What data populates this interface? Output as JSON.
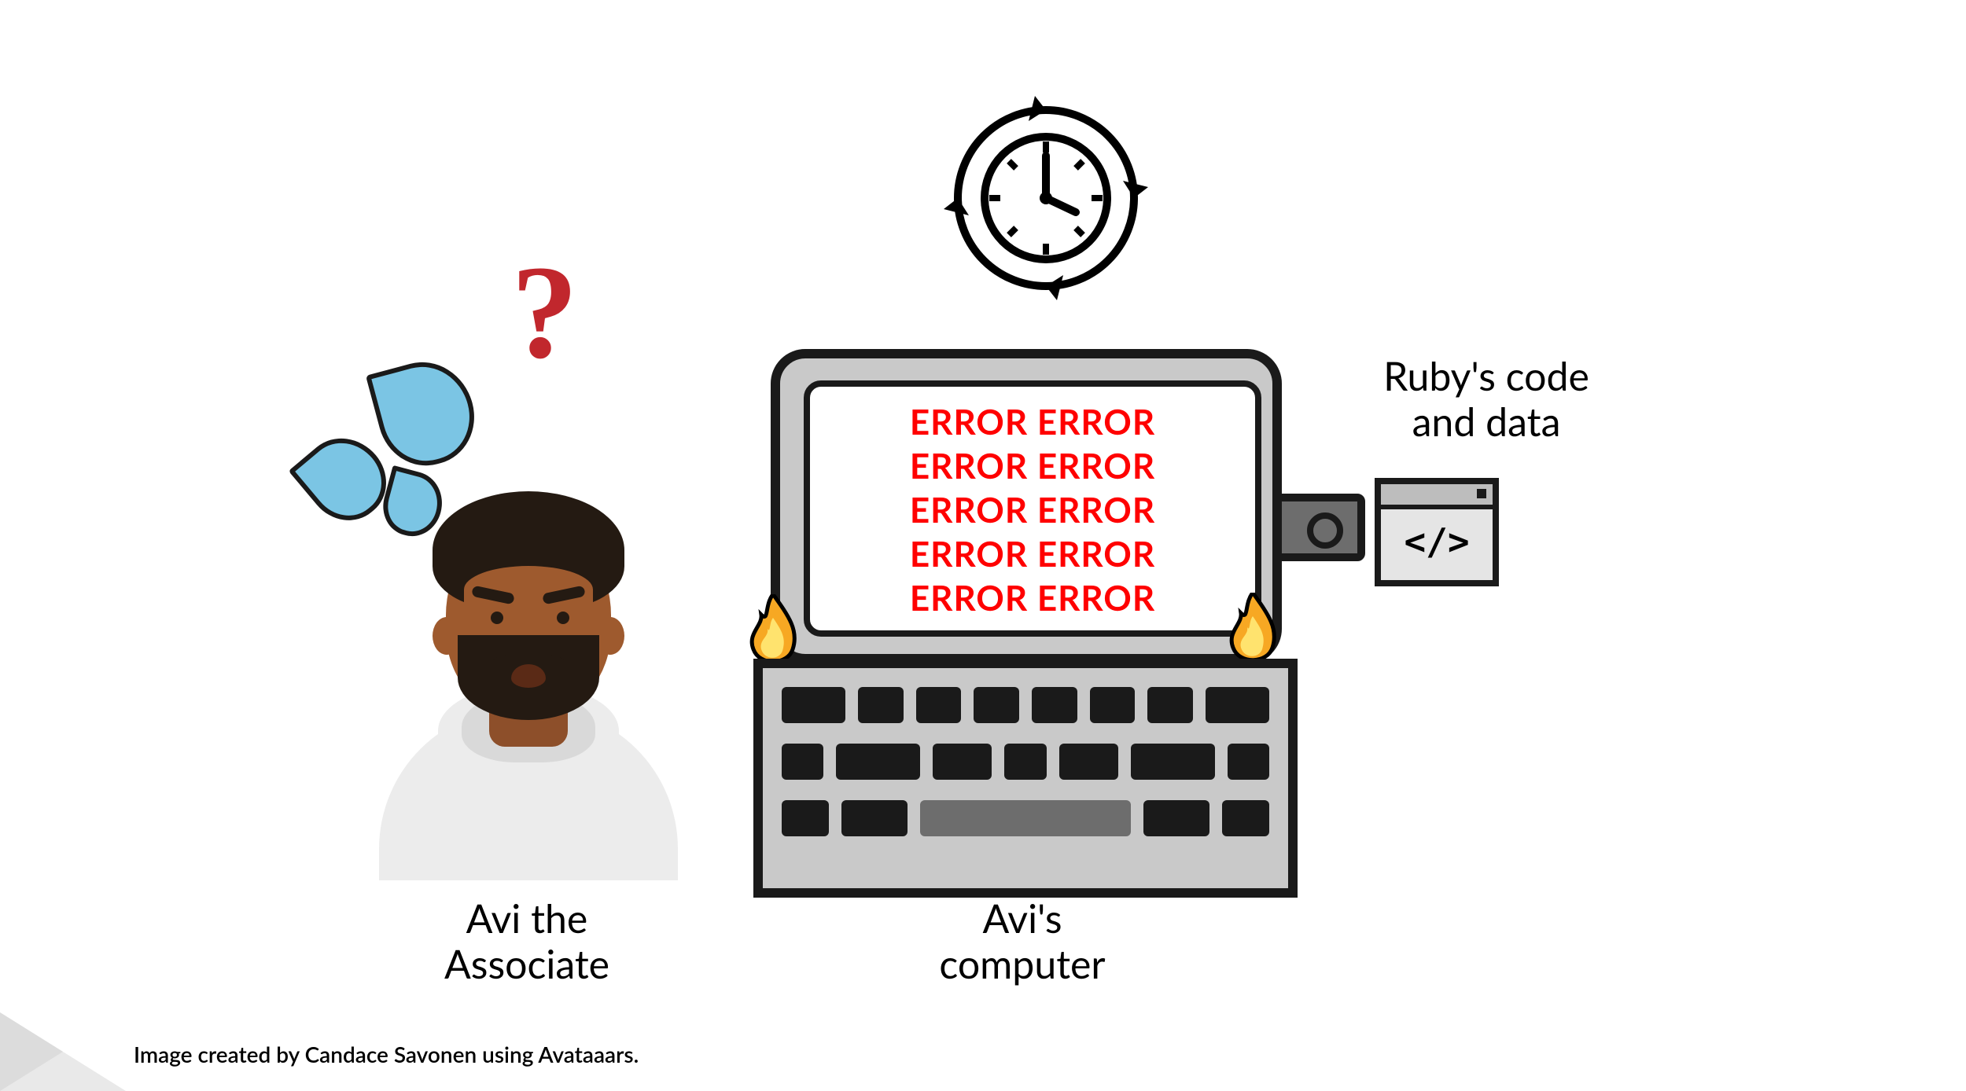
{
  "labels": {
    "avi": "Avi the\nAssociate",
    "computer": "Avi's\ncomputer",
    "ruby": "Ruby's code\nand data"
  },
  "screen": {
    "lines": [
      "ERROR ERROR",
      "ERROR ERROR",
      "ERROR ERROR",
      "ERROR ERROR",
      "ERROR ERROR"
    ]
  },
  "symbols": {
    "question_mark": "?",
    "code_glyph": "</>"
  },
  "credit": "Image created by Candace Savonen using Avataaars.",
  "colors": {
    "error_text": "#ff0000",
    "question_mark": "#c1272d",
    "sweat_drop_fill": "#7bc5e4",
    "flame_outer": "#f7a823",
    "flame_inner": "#ffe36e"
  }
}
